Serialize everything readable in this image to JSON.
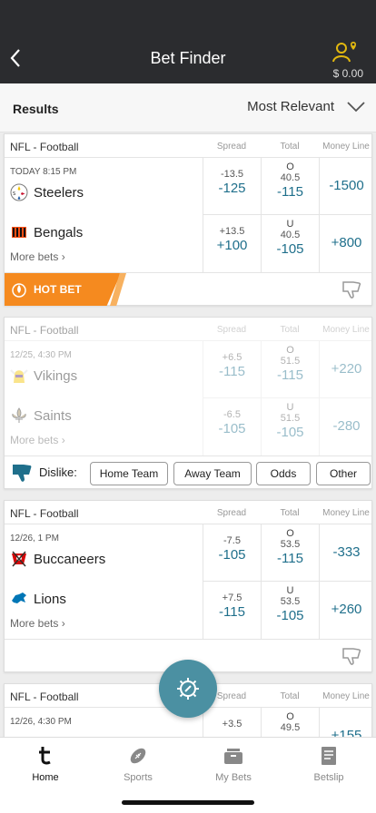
{
  "header": {
    "title": "Bet Finder",
    "balance": "$ 0.00"
  },
  "results": {
    "label": "Results",
    "sort": "Most Relevant"
  },
  "columns": {
    "spread": "Spread",
    "total": "Total",
    "moneyline": "Money Line"
  },
  "cards": [
    {
      "league": "NFL - Football",
      "time": "TODAY 8:15 PM",
      "team1": {
        "name": "Steelers",
        "spread_line": "-13.5",
        "spread_price": "-125",
        "total_side": "O",
        "total_line": "40.5",
        "total_price": "-115",
        "ml": "-1500"
      },
      "team2": {
        "name": "Bengals",
        "spread_line": "+13.5",
        "spread_price": "+100",
        "total_side": "U",
        "total_line": "40.5",
        "total_price": "-105",
        "ml": "+800"
      },
      "more": "More bets",
      "hot_label": "HOT BET"
    },
    {
      "league": "NFL - Football",
      "time": "12/25, 4:30 PM",
      "team1": {
        "name": "Vikings",
        "spread_line": "+6.5",
        "spread_price": "-115",
        "total_side": "O",
        "total_line": "51.5",
        "total_price": "-115",
        "ml": "+220"
      },
      "team2": {
        "name": "Saints",
        "spread_line": "-6.5",
        "spread_price": "-105",
        "total_side": "U",
        "total_line": "51.5",
        "total_price": "-105",
        "ml": "-280"
      },
      "more": "More bets",
      "dislike_label": "Dislike:",
      "dislike_options": [
        "Home Team",
        "Away Team",
        "Odds",
        "Other"
      ]
    },
    {
      "league": "NFL - Football",
      "time": "12/26, 1 PM",
      "team1": {
        "name": "Buccaneers",
        "spread_line": "-7.5",
        "spread_price": "-105",
        "total_side": "O",
        "total_line": "53.5",
        "total_price": "-115",
        "ml": "-333"
      },
      "team2": {
        "name": "Lions",
        "spread_line": "+7.5",
        "spread_price": "-115",
        "total_side": "U",
        "total_line": "53.5",
        "total_price": "-105",
        "ml": "+260"
      },
      "more": "More bets"
    },
    {
      "league": "NFL - Football",
      "time": "12/26, 4:30 PM",
      "team1": {
        "spread_line": "+3.5",
        "total_side": "O",
        "total_line": "49.5",
        "ml": "+155"
      }
    }
  ],
  "tabs": [
    {
      "label": "Home"
    },
    {
      "label": "Sports"
    },
    {
      "label": "My Bets"
    },
    {
      "label": "Betslip"
    }
  ],
  "colors": {
    "accent": "#1f6f8b",
    "hot": "#f58a1f",
    "topbar": "#2b2c2f",
    "fab": "#4b90a2",
    "gold": "#e2b80f"
  }
}
